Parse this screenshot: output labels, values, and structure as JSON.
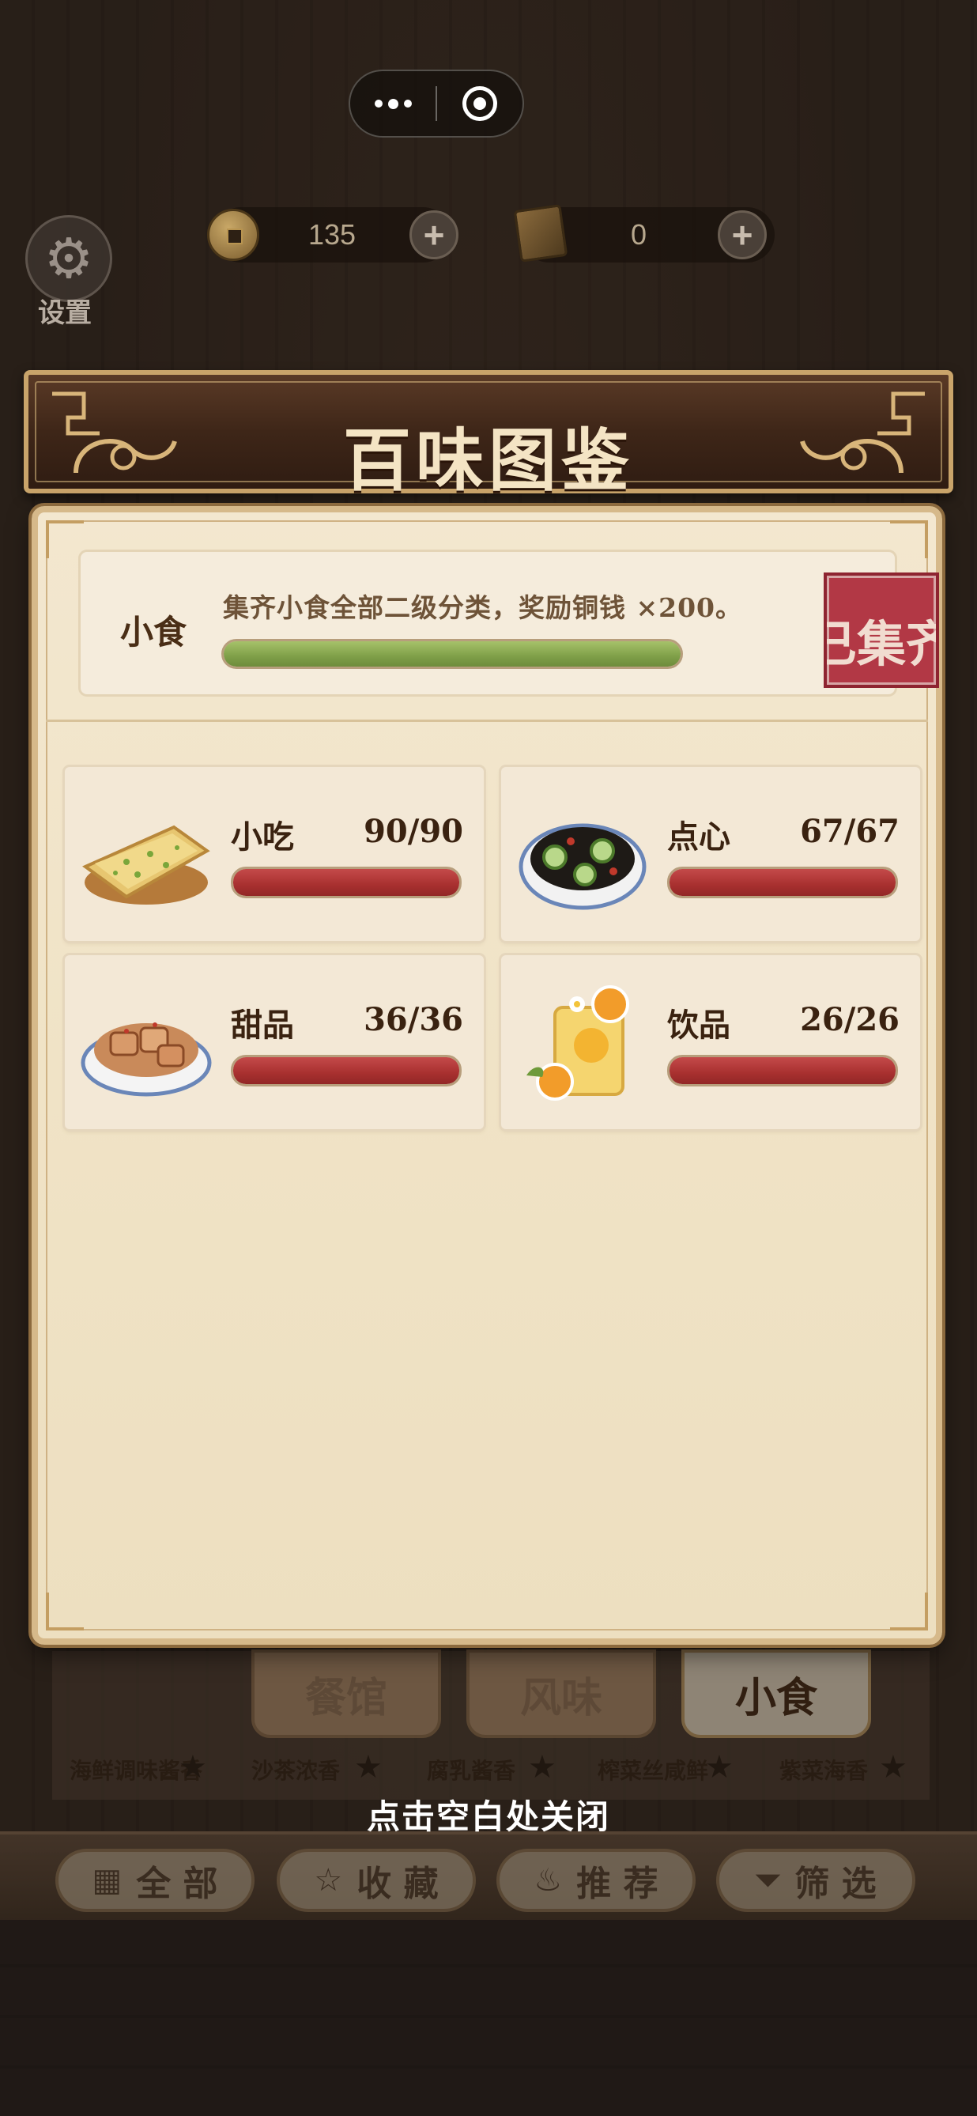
{
  "capsule": {
    "more_label": "•••",
    "close_label": "◉"
  },
  "currency": {
    "coins": {
      "value": "135",
      "add": "+"
    },
    "books": {
      "value": "0",
      "add": "+"
    }
  },
  "settings": {
    "label": "设置"
  },
  "banner": {
    "title": "百味图鉴"
  },
  "summary": {
    "title": "小食",
    "description": "集齐小食全部二级分类，奖励铜钱 ×200。",
    "progress": 1.0,
    "stamp": "已集齐"
  },
  "categories": [
    {
      "name": "小吃",
      "count": "90/90",
      "progress": 1.0,
      "icon": "scallion-pancake-icon"
    },
    {
      "name": "点心",
      "count": "67/67",
      "progress": 1.0,
      "icon": "cucumber-salad-icon"
    },
    {
      "name": "甜品",
      "count": "36/36",
      "progress": 1.0,
      "icon": "glazed-meat-icon"
    },
    {
      "name": "饮品",
      "count": "26/26",
      "progress": 1.0,
      "icon": "orange-drink-icon"
    }
  ],
  "tabs": [
    {
      "label": "餐馆",
      "active": false
    },
    {
      "label": "风味",
      "active": false
    },
    {
      "label": "小食",
      "active": true
    }
  ],
  "dishes": [
    {
      "label": "海鲜调味酱香"
    },
    {
      "label": "沙茶浓香"
    },
    {
      "label": "腐乳酱香"
    },
    {
      "label": "榨菜丝咸鲜"
    },
    {
      "label": "紫菜海香"
    }
  ],
  "close_hint": "点击空白处关闭",
  "bottom_nav": [
    {
      "label": "全 部",
      "icon": "grid-icon"
    },
    {
      "label": "收 藏",
      "icon": "star-icon"
    },
    {
      "label": "推 荐",
      "icon": "flame-icon"
    },
    {
      "label": "筛 选",
      "icon": "filter-icon"
    }
  ],
  "colors": {
    "accent_green": "#7f9f48",
    "accent_red": "#a8302f",
    "stamp_red": "#b23845",
    "text_dark": "#3a2210"
  }
}
